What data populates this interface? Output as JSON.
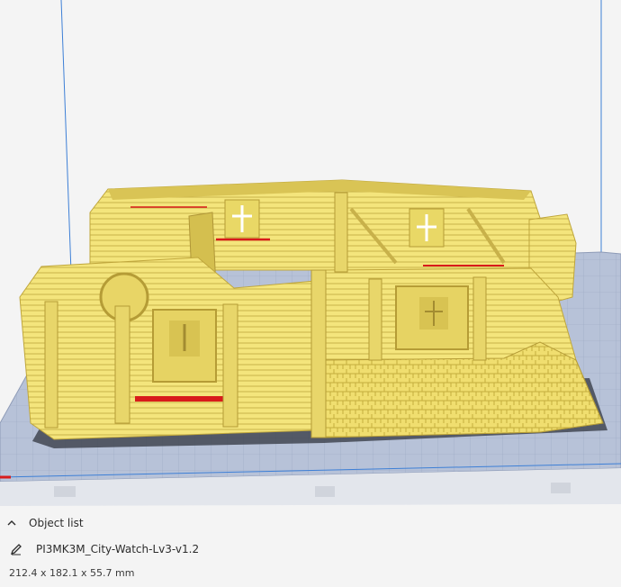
{
  "object_panel": {
    "toggle_label": "Object list",
    "object_name": "PI3MK3M_City-Watch-Lv3-v1.2",
    "dimensions": "212.4 x 182.1 x 55.7 mm"
  },
  "colors": {
    "background": "#f4f4f4",
    "model": "#f2e37a",
    "model_shadow": "#c9b448",
    "build_plate": "#a9b6cf",
    "build_volume_line": "#3d7fd6",
    "overhang": "#d81b1b"
  },
  "icons": {
    "toggle": "chevron-up-icon",
    "edit": "pencil-icon"
  }
}
